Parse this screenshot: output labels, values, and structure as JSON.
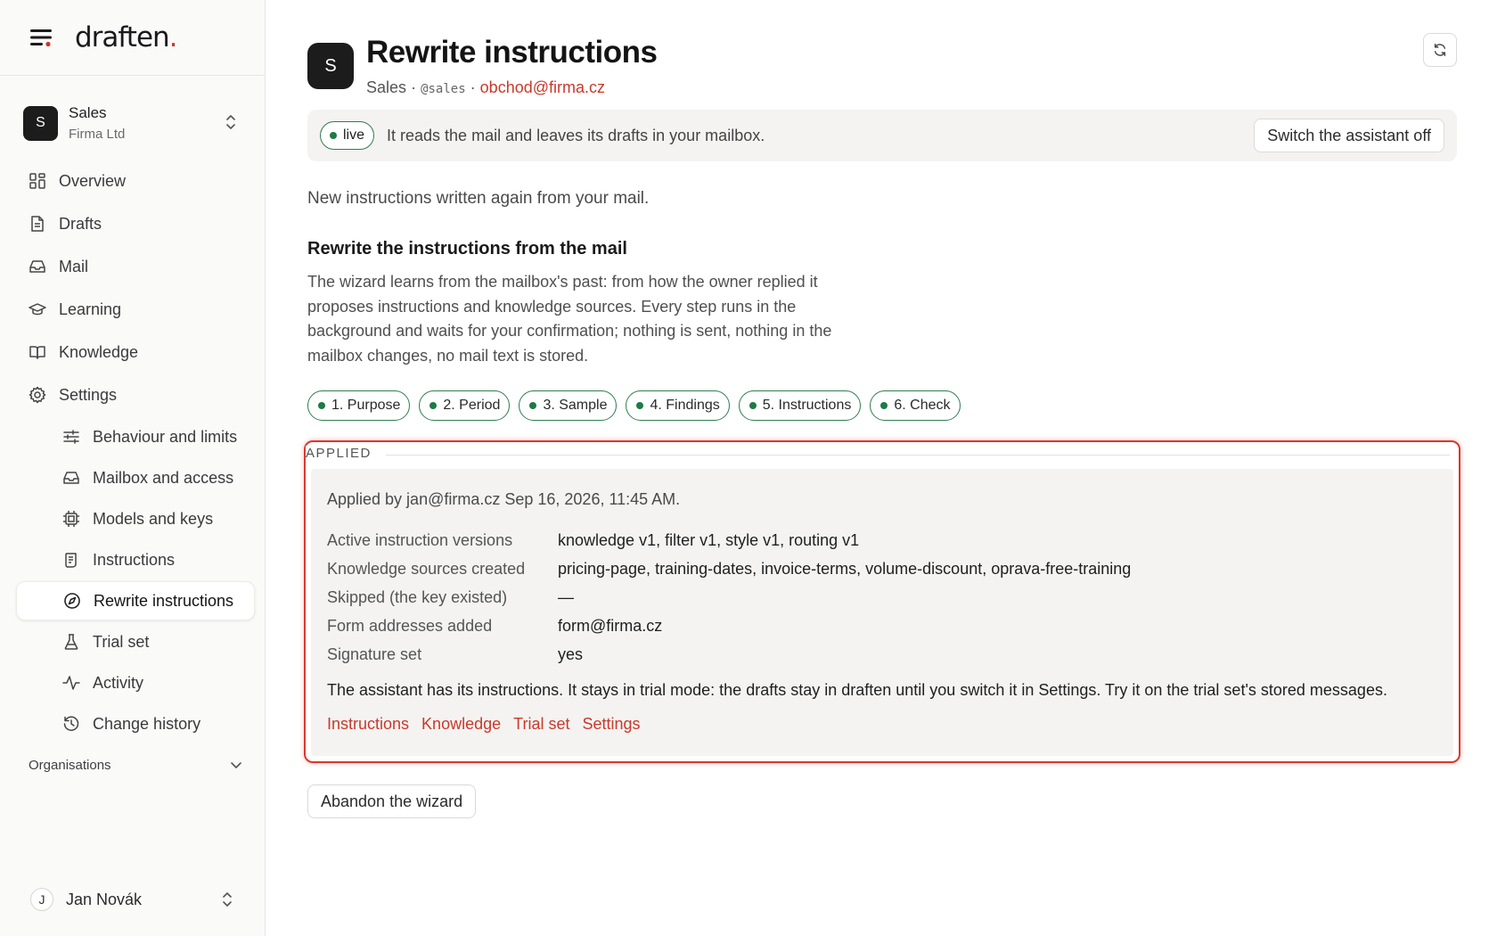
{
  "app": {
    "logo_text": "draften",
    "logo_dot": "."
  },
  "workspace": {
    "avatar": "S",
    "name": "Sales",
    "org": "Firma Ltd"
  },
  "nav": {
    "overview": "Overview",
    "drafts": "Drafts",
    "mail": "Mail",
    "learning": "Learning",
    "knowledge": "Knowledge",
    "settings": "Settings",
    "sub": {
      "behaviour": "Behaviour and limits",
      "mailbox": "Mailbox and access",
      "models": "Models and keys",
      "instructions": "Instructions",
      "rewrite": "Rewrite instructions",
      "trial": "Trial set",
      "activity": "Activity",
      "history": "Change history"
    }
  },
  "organisations_label": "Organisations",
  "user": {
    "initial": "J",
    "name": "Jan Novák"
  },
  "header": {
    "avatar": "S",
    "title": "Rewrite instructions",
    "mailbox_name": "Sales",
    "separator": "·",
    "handle": "@sales",
    "email": "obchod@firma.cz"
  },
  "status": {
    "badge": "live",
    "text": "It reads the mail and leaves its drafts in your mailbox.",
    "switch_label": "Switch the assistant off"
  },
  "intro": "New instructions written again from your mail.",
  "section": {
    "title": "Rewrite the instructions from the mail",
    "description": "The wizard learns from the mailbox's past: from how the owner replied it proposes instructions and knowledge sources. Every step runs in the background and waits for your confirmation; nothing is sent, nothing in the mailbox changes, no mail text is stored."
  },
  "steps": [
    "1. Purpose",
    "2. Period",
    "3. Sample",
    "4. Findings",
    "5. Instructions",
    "6. Check"
  ],
  "applied": {
    "legend": "APPLIED",
    "by_line": "Applied by jan@firma.cz Sep 16, 2026, 11:45 AM.",
    "rows": [
      {
        "key": "Active instruction versions",
        "value": "knowledge v1, filter v1, style v1, routing v1"
      },
      {
        "key": "Knowledge sources created",
        "value": "pricing-page, training-dates, invoice-terms, volume-discount, oprava-free-training"
      },
      {
        "key": "Skipped (the key existed)",
        "value": "—"
      },
      {
        "key": "Form addresses added",
        "value": "form@firma.cz"
      },
      {
        "key": "Signature set",
        "value": "yes"
      }
    ],
    "result": "The assistant has its instructions. It stays in trial mode: the drafts stay in draften until you switch it in Settings. Try it on the trial set's stored messages.",
    "links": [
      "Instructions",
      "Knowledge",
      "Trial set",
      "Settings"
    ]
  },
  "abandon_label": "Abandon the wizard",
  "colors": {
    "accent": "#c9392b",
    "live_green": "#1f7a44",
    "highlight_border": "#d9382d"
  }
}
